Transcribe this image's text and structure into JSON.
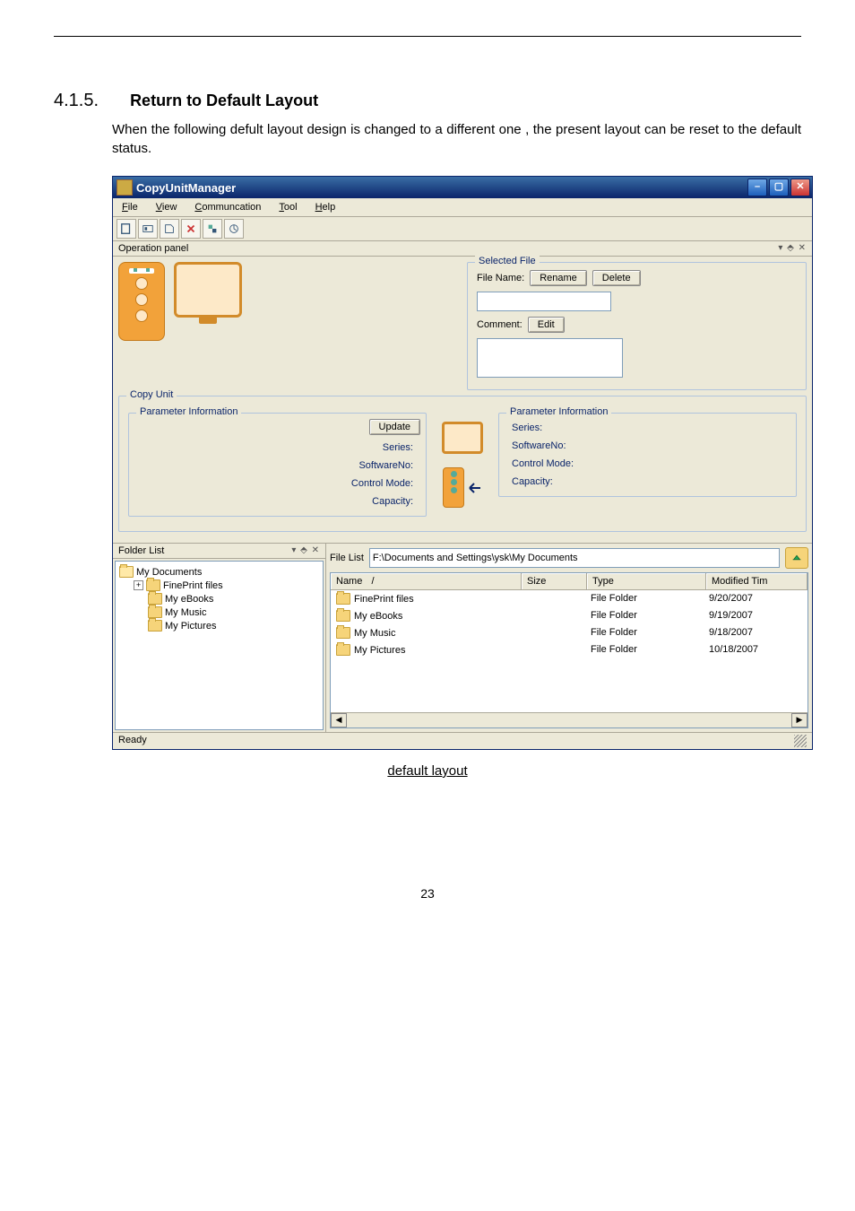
{
  "doc": {
    "section_number": "4.1.5.",
    "section_title": "Return to Default Layout",
    "body_text": "When the following defult layout design is changed to a different one , the present layout can be reset to the default status.",
    "caption": "default layout",
    "page_number": "23"
  },
  "window": {
    "title": "CopyUnitManager",
    "menu": {
      "file": "File",
      "view": "View",
      "communication": "Communcation",
      "tool": "Tool",
      "help": "Help"
    },
    "op_panel": {
      "title": "Operation panel",
      "dock_ctrls": "▾ ⬘ ✕",
      "selected_file": {
        "legend": "Selected File",
        "filename_label": "File Name:",
        "rename": "Rename",
        "delete": "Delete",
        "comment_label": "Comment:",
        "edit": "Edit"
      },
      "copy_unit": {
        "legend": "Copy Unit",
        "update": "Update",
        "param_left": {
          "legend": "Parameter Information",
          "series": "Series:",
          "software": "SoftwareNo:",
          "control": "Control Mode:",
          "capacity": "Capacity:"
        },
        "param_right": {
          "legend": "Parameter Information",
          "series": "Series:",
          "software": "SoftwareNo:",
          "control": "Control Mode:",
          "capacity": "Capacity:"
        }
      }
    },
    "folder_list": {
      "title": "Folder List",
      "dock_ctrls": "▾ ⬘ ✕",
      "root": "My Documents",
      "items": [
        "FinePrint files",
        "My eBooks",
        "My Music",
        "My Pictures"
      ]
    },
    "file_list": {
      "label": "File List",
      "path": "F:\\Documents and Settings\\ysk\\My Documents",
      "columns": {
        "name": "Name",
        "size": "Size",
        "type": "Type",
        "modified": "Modified Tim"
      },
      "rows": [
        {
          "name": "FinePrint files",
          "size": "",
          "type": "File Folder",
          "date": "9/20/2007"
        },
        {
          "name": "My eBooks",
          "size": "",
          "type": "File Folder",
          "date": "9/19/2007"
        },
        {
          "name": "My Music",
          "size": "",
          "type": "File Folder",
          "date": "9/18/2007"
        },
        {
          "name": "My Pictures",
          "size": "",
          "type": "File Folder",
          "date": "10/18/2007"
        }
      ]
    },
    "statusbar": {
      "text": "Ready"
    }
  }
}
